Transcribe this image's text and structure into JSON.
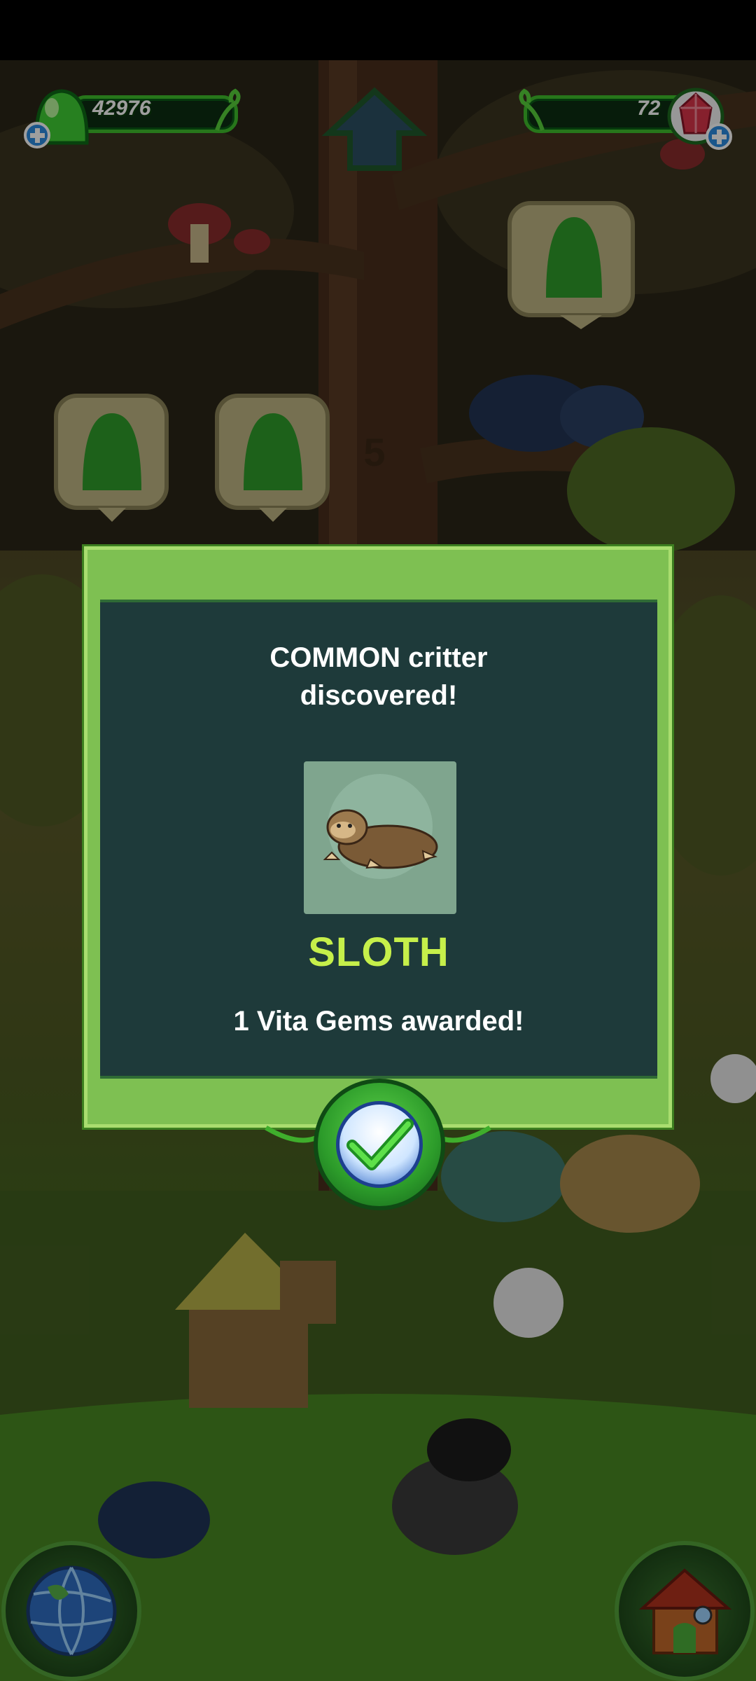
{
  "hud": {
    "goo_count": "42976",
    "gem_count": "72"
  },
  "dialog": {
    "title_line1": "COMMON critter",
    "title_line2": "discovered!",
    "critter_name": "SLOTH",
    "award_text": "1 Vita Gems awarded!"
  },
  "colors": {
    "dialog_frame": "#7ec052",
    "dialog_panel": "#1e3a3a",
    "critter_name": "#c6ef4a",
    "hud_bar_border": "#3fbf2c"
  },
  "icons": {
    "goo": "green-goo-icon",
    "gem": "red-gem-icon",
    "confirm": "checkmark-icon",
    "globe": "globe-icon",
    "house": "house-icon",
    "up": "up-arrow-icon"
  }
}
